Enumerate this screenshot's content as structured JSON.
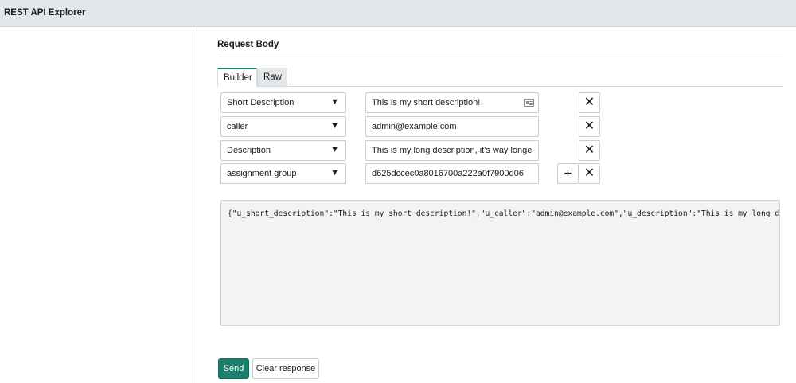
{
  "app": {
    "title": "REST API Explorer"
  },
  "request_body": {
    "title": "Request Body",
    "tabs": [
      {
        "label": "Builder",
        "active": true
      },
      {
        "label": "Raw",
        "active": false
      }
    ],
    "fields": [
      {
        "field": "Short Description",
        "value": "This is my short description!"
      },
      {
        "field": "caller",
        "value": "admin@example.com"
      },
      {
        "field": "Description",
        "value": "This is my long description, it's way longer tl"
      },
      {
        "field": "assignment group",
        "value": "d625dccec0a8016700a222a0f7900d06"
      }
    ],
    "dropdown_arrow": "▼",
    "remove_symbol": "✕",
    "add_symbol": "+",
    "json_preview": "{\"u_short_description\":\"This is my short description!\",\"u_caller\":\"admin@example.com\",\"u_description\":\"This is my long des"
  },
  "actions": {
    "send_label": "Send",
    "clear_label": "Clear response"
  },
  "colors": {
    "accent": "#1d7e6e",
    "header_bg": "#e4e7ea",
    "json_bg": "#f3f3f3"
  }
}
